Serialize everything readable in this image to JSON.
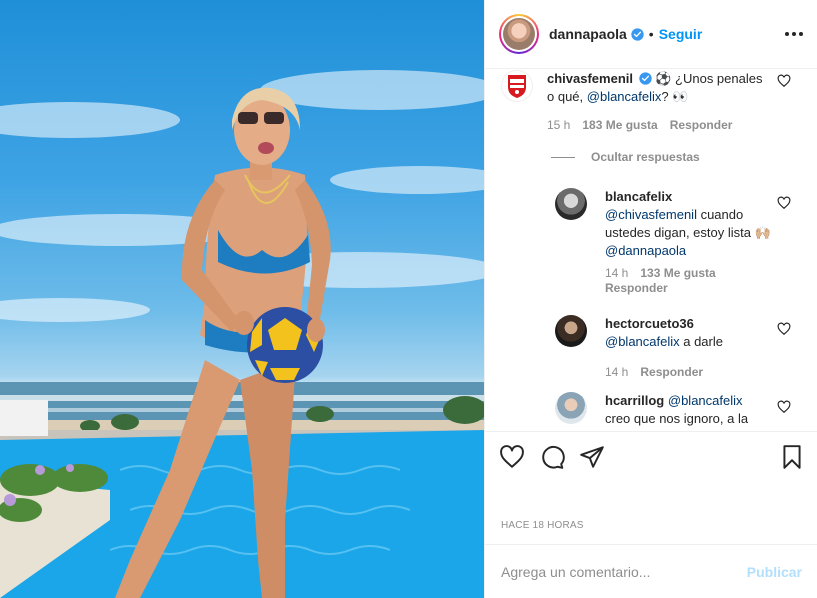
{
  "post": {
    "username": "dannapaola",
    "follow_label": "Seguir",
    "separator": "•",
    "time_ago": "HACE 18 HORAS",
    "photo_icon": "photo-woman-with-ball-by-pool"
  },
  "comments": [
    {
      "username": "chivasfemenil",
      "verified": true,
      "text": " ⚽ ¿Unos penales o qué, ",
      "mention": "@blancafelix",
      "text_after": "? 👀",
      "time": "15 h",
      "likes": "183 Me gusta",
      "reply": "Responder"
    }
  ],
  "hide_replies": "Ocultar respuestas",
  "replies": [
    {
      "username": "blancafelix",
      "mention": "@chivasfemenil",
      "text": " cuando ustedes digan, estoy lista 🙌🏼 ",
      "mention2": "@dannapaola",
      "time": "14 h",
      "likes": "133 Me gusta",
      "reply": "Responder"
    },
    {
      "username": "hectorcueto36",
      "mention": "@blancafelix",
      "text": " a darle",
      "time": "14 h",
      "reply": "Responder"
    },
    {
      "username": "hcarrillog",
      "mention": "@blancafelix",
      "text": "creo que nos ignoro, a la"
    }
  ],
  "add_comment": {
    "placeholder": "Agrega un comentario...",
    "publish_label": "Publicar"
  },
  "colors": {
    "link_blue": "#0095f6",
    "mention": "#00376b",
    "muted": "#8e8e8e",
    "publish_disabled": "#b2dffc"
  }
}
